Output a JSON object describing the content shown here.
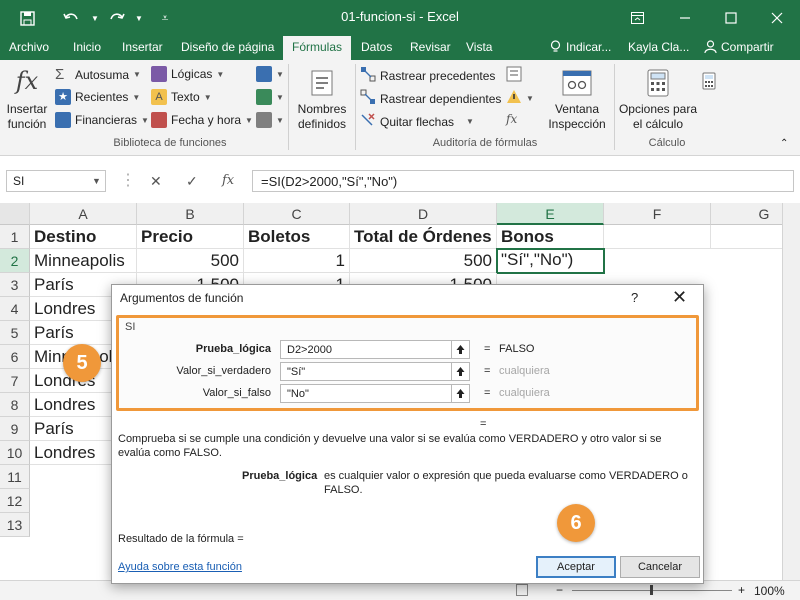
{
  "window": {
    "title": "01-funcion-si  -  Excel",
    "user": "Kayla Cla...",
    "share_label": "Compartir",
    "tell_me": "Indicar..."
  },
  "tabs": [
    "Archivo",
    "Inicio",
    "Insertar",
    "Diseño de página",
    "Fórmulas",
    "Datos",
    "Revisar",
    "Vista"
  ],
  "active_tab": "Fórmulas",
  "ribbon": {
    "insert_function": "Insertar\nfunción",
    "library": {
      "autosum": "Autosuma",
      "recent": "Recientes",
      "financial": "Financieras",
      "logical": "Lógicas",
      "text": "Texto",
      "datetime": "Fecha y hora",
      "group_label": "Biblioteca de funciones"
    },
    "defined_names": "Nombres\ndefinidos",
    "audit": {
      "trace_precedents": "Rastrear precedentes",
      "trace_dependents": "Rastrear dependientes",
      "remove_arrows": "Quitar flechas",
      "watch_window": "Ventana\nInspección",
      "group_label": "Auditoría de fórmulas"
    },
    "calc": {
      "options": "Opciones para\nel cálculo",
      "group_label": "Cálculo"
    }
  },
  "formula_bar": {
    "name_box": "SI",
    "formula": "=SI(D2>2000,\"Sí\",\"No\")"
  },
  "sheet": {
    "columns": [
      "A",
      "B",
      "C",
      "D",
      "E",
      "F",
      "G"
    ],
    "rows": [
      "1",
      "2",
      "3",
      "4",
      "5",
      "6",
      "7",
      "8",
      "9",
      "10",
      "11",
      "12",
      "13"
    ],
    "headers": [
      "Destino",
      "Precio",
      "Boletos",
      "Total de Órdenes",
      "Bonos"
    ],
    "row2": {
      "destino": "Minneapolis",
      "precio": "500",
      "boletos": "1",
      "total": "500",
      "bonos": "\"Sí\",\"No\")"
    },
    "row3": {
      "destino": "París",
      "precio": "1,500",
      "boletos": "1",
      "total": "1,500"
    },
    "row4": {
      "destino": "Londres"
    },
    "row5": {
      "destino": "París"
    },
    "row6": {
      "destino": "Minneapolis"
    },
    "row7": {
      "destino": "Londres"
    },
    "row8": {
      "destino": "Londres"
    },
    "row9": {
      "destino": "París"
    },
    "row10": {
      "destino": "Londres"
    }
  },
  "dialog": {
    "title": "Argumentos de función",
    "help": "?",
    "function_name": "SI",
    "args": [
      {
        "label": "Prueba_lógica",
        "value": "D2>2000",
        "result": "FALSO",
        "bold": true
      },
      {
        "label": "Valor_si_verdadero",
        "value": "\"Sí\"",
        "result": "cualquiera",
        "bold": false
      },
      {
        "label": "Valor_si_falso",
        "value": "\"No\"",
        "result": "cualquiera",
        "bold": false
      }
    ],
    "equals_sign": "=",
    "description": "Comprueba si se cumple una condición y devuelve una valor si se evalúa como VERDADERO y otro valor si se evalúa como FALSO.",
    "arg_help_name": "Prueba_lógica",
    "arg_help_text": "es cualquier valor o expresión que pueda evaluarse como VERDADERO o FALSO.",
    "result_label": "Resultado de la fórmula =",
    "help_link": "Ayuda sobre esta función",
    "ok": "Aceptar",
    "cancel": "Cancelar"
  },
  "status": {
    "zoom": "100%"
  },
  "callouts": [
    "5",
    "6"
  ],
  "colors": {
    "excel_green": "#217346",
    "highlight_orange": "#f0983a"
  }
}
